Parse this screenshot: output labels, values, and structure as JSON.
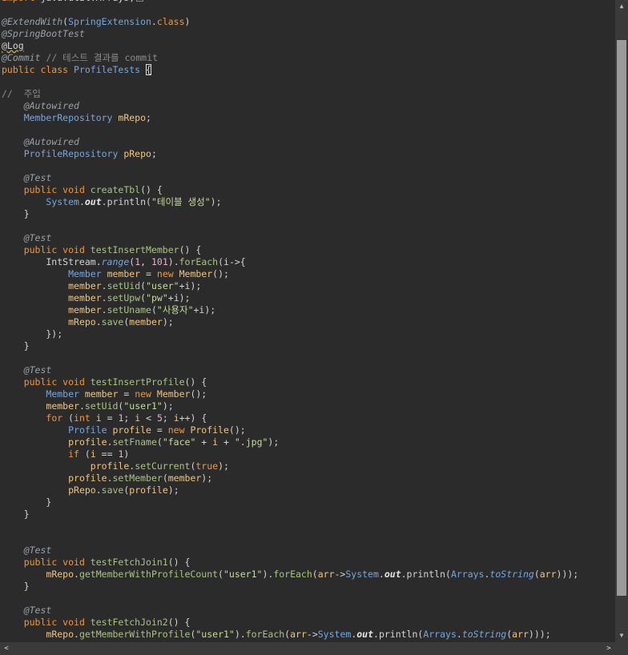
{
  "editor": {
    "lines": [
      [
        [
          "kw",
          "import "
        ],
        [
          "plain",
          "java.util.Arrays;"
        ],
        [
          "fold",
          ""
        ]
      ],
      [],
      [
        [
          "ann",
          "@ExtendWith"
        ],
        [
          "plain",
          "("
        ],
        [
          "type",
          "SpringExtension"
        ],
        [
          "plain",
          "."
        ],
        [
          "kw",
          "class"
        ],
        [
          "plain",
          ")"
        ]
      ],
      [
        [
          "ann",
          "@SpringBootTest"
        ]
      ],
      [
        [
          "err",
          "@Log"
        ]
      ],
      [
        [
          "ann",
          "@Commit"
        ],
        [
          "plain",
          " "
        ],
        [
          "cmt",
          "// 테스트 결과를 commit"
        ]
      ],
      [
        [
          "kw",
          "public class "
        ],
        [
          "type",
          "ProfileTests "
        ],
        [
          "brk",
          "{"
        ]
      ],
      [],
      [
        [
          "cmt",
          "//  주입"
        ]
      ],
      [
        [
          "plain",
          "    "
        ],
        [
          "ann",
          "@Autowired"
        ]
      ],
      [
        [
          "plain",
          "    "
        ],
        [
          "type",
          "MemberRepository "
        ],
        [
          "var",
          "mRepo"
        ],
        [
          "plain",
          ";"
        ]
      ],
      [],
      [
        [
          "plain",
          "    "
        ],
        [
          "ann",
          "@Autowired"
        ]
      ],
      [
        [
          "plain",
          "    "
        ],
        [
          "type",
          "ProfileRepository "
        ],
        [
          "var",
          "pRepo"
        ],
        [
          "plain",
          ";"
        ]
      ],
      [],
      [
        [
          "plain",
          "    "
        ],
        [
          "ann",
          "@Test"
        ]
      ],
      [
        [
          "plain",
          "    "
        ],
        [
          "kw",
          "public void "
        ],
        [
          "meth",
          "createTbl"
        ],
        [
          "plain",
          "() {"
        ]
      ],
      [
        [
          "plain",
          "        "
        ],
        [
          "type",
          "System"
        ],
        [
          "plain",
          "."
        ],
        [
          "fld",
          "out"
        ],
        [
          "plain",
          ".println("
        ],
        [
          "str",
          "\"테이블 생성\""
        ],
        [
          "plain",
          ");"
        ]
      ],
      [
        [
          "plain",
          "    }"
        ]
      ],
      [],
      [
        [
          "plain",
          "    "
        ],
        [
          "ann",
          "@Test"
        ]
      ],
      [
        [
          "plain",
          "    "
        ],
        [
          "kw",
          "public void "
        ],
        [
          "meth",
          "testInsertMember"
        ],
        [
          "plain",
          "() {"
        ]
      ],
      [
        [
          "plain",
          "        IntStream."
        ],
        [
          "stat",
          "range"
        ],
        [
          "plain",
          "("
        ],
        [
          "num",
          "1"
        ],
        [
          "plain",
          ", "
        ],
        [
          "num",
          "101"
        ],
        [
          "plain",
          ")."
        ],
        [
          "meth",
          "forEach"
        ],
        [
          "plain",
          "(i->{"
        ]
      ],
      [
        [
          "plain",
          "            "
        ],
        [
          "type",
          "Member "
        ],
        [
          "var",
          "member"
        ],
        [
          "plain",
          " = "
        ],
        [
          "kw",
          "new "
        ],
        [
          "var",
          "Member"
        ],
        [
          "plain",
          "();"
        ]
      ],
      [
        [
          "plain",
          "            "
        ],
        [
          "var",
          "member"
        ],
        [
          "plain",
          "."
        ],
        [
          "meth",
          "setUid"
        ],
        [
          "plain",
          "("
        ],
        [
          "str",
          "\"user\""
        ],
        [
          "plain",
          "+i);"
        ]
      ],
      [
        [
          "plain",
          "            "
        ],
        [
          "var",
          "member"
        ],
        [
          "plain",
          "."
        ],
        [
          "meth",
          "setUpw"
        ],
        [
          "plain",
          "("
        ],
        [
          "str",
          "\"pw\""
        ],
        [
          "plain",
          "+i);"
        ]
      ],
      [
        [
          "plain",
          "            "
        ],
        [
          "var",
          "member"
        ],
        [
          "plain",
          "."
        ],
        [
          "meth",
          "setUname"
        ],
        [
          "plain",
          "("
        ],
        [
          "str",
          "\"사용자\""
        ],
        [
          "plain",
          "+i);"
        ]
      ],
      [
        [
          "plain",
          "            "
        ],
        [
          "var",
          "mRepo"
        ],
        [
          "plain",
          "."
        ],
        [
          "meth",
          "save"
        ],
        [
          "plain",
          "("
        ],
        [
          "var",
          "member"
        ],
        [
          "plain",
          ");"
        ]
      ],
      [
        [
          "plain",
          "        });"
        ]
      ],
      [
        [
          "plain",
          "    }"
        ]
      ],
      [],
      [
        [
          "plain",
          "    "
        ],
        [
          "ann",
          "@Test"
        ]
      ],
      [
        [
          "plain",
          "    "
        ],
        [
          "kw",
          "public void "
        ],
        [
          "meth",
          "testInsertProfile"
        ],
        [
          "plain",
          "() {"
        ]
      ],
      [
        [
          "plain",
          "        "
        ],
        [
          "type",
          "Member "
        ],
        [
          "var",
          "member"
        ],
        [
          "plain",
          " = "
        ],
        [
          "kw",
          "new "
        ],
        [
          "var",
          "Member"
        ],
        [
          "plain",
          "();"
        ]
      ],
      [
        [
          "plain",
          "        "
        ],
        [
          "var",
          "member"
        ],
        [
          "plain",
          "."
        ],
        [
          "meth",
          "setUid"
        ],
        [
          "plain",
          "("
        ],
        [
          "str",
          "\"user1\""
        ],
        [
          "plain",
          ");"
        ]
      ],
      [
        [
          "plain",
          "        "
        ],
        [
          "kw",
          "for "
        ],
        [
          "plain",
          "("
        ],
        [
          "kw",
          "int "
        ],
        [
          "var",
          "i"
        ],
        [
          "plain",
          " = "
        ],
        [
          "num",
          "1"
        ],
        [
          "plain",
          "; "
        ],
        [
          "var",
          "i"
        ],
        [
          "plain",
          " < "
        ],
        [
          "num",
          "5"
        ],
        [
          "plain",
          "; "
        ],
        [
          "var",
          "i"
        ],
        [
          "plain",
          "++) {"
        ]
      ],
      [
        [
          "plain",
          "            "
        ],
        [
          "type",
          "Profile "
        ],
        [
          "var",
          "profile"
        ],
        [
          "plain",
          " = "
        ],
        [
          "kw",
          "new "
        ],
        [
          "var",
          "Profile"
        ],
        [
          "plain",
          "();"
        ]
      ],
      [
        [
          "plain",
          "            "
        ],
        [
          "var",
          "profile"
        ],
        [
          "plain",
          "."
        ],
        [
          "meth",
          "setFname"
        ],
        [
          "plain",
          "("
        ],
        [
          "str",
          "\"face\""
        ],
        [
          "plain",
          " + "
        ],
        [
          "var",
          "i"
        ],
        [
          "plain",
          " + "
        ],
        [
          "str",
          "\".jpg\""
        ],
        [
          "plain",
          ");"
        ]
      ],
      [
        [
          "plain",
          "            "
        ],
        [
          "kw",
          "if "
        ],
        [
          "plain",
          "("
        ],
        [
          "var",
          "i"
        ],
        [
          "plain",
          " == "
        ],
        [
          "num",
          "1"
        ],
        [
          "plain",
          ")"
        ]
      ],
      [
        [
          "plain",
          "                "
        ],
        [
          "var",
          "profile"
        ],
        [
          "plain",
          "."
        ],
        [
          "meth",
          "setCurrent"
        ],
        [
          "plain",
          "("
        ],
        [
          "kw",
          "true"
        ],
        [
          "plain",
          ");"
        ]
      ],
      [
        [
          "plain",
          "            "
        ],
        [
          "var",
          "profile"
        ],
        [
          "plain",
          "."
        ],
        [
          "meth",
          "setMember"
        ],
        [
          "plain",
          "("
        ],
        [
          "var",
          "member"
        ],
        [
          "plain",
          ");"
        ]
      ],
      [
        [
          "plain",
          "            "
        ],
        [
          "var",
          "pRepo"
        ],
        [
          "plain",
          "."
        ],
        [
          "meth",
          "save"
        ],
        [
          "plain",
          "("
        ],
        [
          "var",
          "profile"
        ],
        [
          "plain",
          ");"
        ]
      ],
      [
        [
          "plain",
          "        }"
        ]
      ],
      [
        [
          "plain",
          "    }"
        ]
      ],
      [],
      [],
      [
        [
          "plain",
          "    "
        ],
        [
          "ann",
          "@Test"
        ]
      ],
      [
        [
          "plain",
          "    "
        ],
        [
          "kw",
          "public void "
        ],
        [
          "meth",
          "testFetchJoin1"
        ],
        [
          "plain",
          "() {"
        ]
      ],
      [
        [
          "plain",
          "        "
        ],
        [
          "var",
          "mRepo"
        ],
        [
          "plain",
          "."
        ],
        [
          "meth",
          "getMemberWithProfileCount"
        ],
        [
          "plain",
          "("
        ],
        [
          "str",
          "\"user1\""
        ],
        [
          "plain",
          ")."
        ],
        [
          "meth",
          "forEach"
        ],
        [
          "plain",
          "("
        ],
        [
          "var",
          "arr"
        ],
        [
          "plain",
          "->"
        ],
        [
          "type",
          "System"
        ],
        [
          "plain",
          "."
        ],
        [
          "fld",
          "out"
        ],
        [
          "plain",
          ".println("
        ],
        [
          "type",
          "Arrays"
        ],
        [
          "plain",
          "."
        ],
        [
          "stat",
          "toString"
        ],
        [
          "plain",
          "("
        ],
        [
          "var",
          "arr"
        ],
        [
          "plain",
          ")));"
        ]
      ],
      [
        [
          "plain",
          "    }"
        ]
      ],
      [],
      [
        [
          "plain",
          "    "
        ],
        [
          "ann",
          "@Test"
        ]
      ],
      [
        [
          "plain",
          "    "
        ],
        [
          "kw",
          "public void "
        ],
        [
          "meth",
          "testFetchJoin2"
        ],
        [
          "plain",
          "() {"
        ]
      ],
      [
        [
          "plain",
          "        "
        ],
        [
          "var",
          "mRepo"
        ],
        [
          "plain",
          "."
        ],
        [
          "meth",
          "getMemberWithProfile"
        ],
        [
          "plain",
          "("
        ],
        [
          "str",
          "\"user1\""
        ],
        [
          "plain",
          ")."
        ],
        [
          "meth",
          "forEach"
        ],
        [
          "plain",
          "("
        ],
        [
          "var",
          "arr"
        ],
        [
          "plain",
          "->"
        ],
        [
          "type",
          "System"
        ],
        [
          "plain",
          "."
        ],
        [
          "fld",
          "out"
        ],
        [
          "plain",
          ".println("
        ],
        [
          "type",
          "Arrays"
        ],
        [
          "plain",
          "."
        ],
        [
          "stat",
          "toString"
        ],
        [
          "plain",
          "("
        ],
        [
          "var",
          "arr"
        ],
        [
          "plain",
          ")));"
        ]
      ]
    ]
  },
  "scrollbars": {
    "vertical": {
      "up_arrow": "▲",
      "down_arrow": "▼"
    },
    "horizontal": {
      "left_arrow": "<",
      "right_arrow": ">"
    }
  },
  "colors": {
    "background": "#2b2b2b",
    "keyword": "#f29733",
    "type": "#74a7e0",
    "string": "#c6dd9a",
    "method": "#a9c47f",
    "variable": "#f0c67a"
  }
}
